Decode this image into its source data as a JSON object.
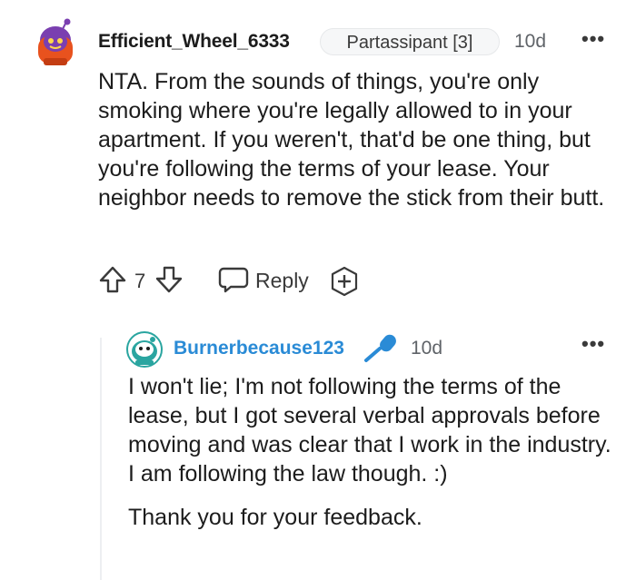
{
  "top_comment": {
    "username": "Efficient_Wheel_6333",
    "flair": "Partassipant [3]",
    "time": "10d",
    "more": "•••",
    "body": "NTA. From the sounds of things, you're only smoking where you're legally allowed to in your apartment. If you weren't, that'd be one thing, but you're following the terms of your lease. Your neighbor needs to remove the stick from their butt.",
    "votes": "7",
    "reply_label": "Reply"
  },
  "reply_comment": {
    "username": "Burnerbecause123",
    "time": "10d",
    "more": "•••",
    "paragraphs": [
      "I won't lie; I'm not following the terms of the lease, but I got several verbal approvals before moving and was clear that I work in the industry. I am following the law though. :)",
      "Thank you for your feedback."
    ]
  },
  "colors": {
    "reply_username": "#2a8bd6",
    "avatar_top": "#e8521e",
    "avatar_reply": "#2aa5a0"
  },
  "icons": [
    "snoo-avatar-icon",
    "upvote-icon",
    "downvote-icon",
    "reply-icon",
    "award-icon",
    "microphone-icon",
    "more-options-icon"
  ]
}
